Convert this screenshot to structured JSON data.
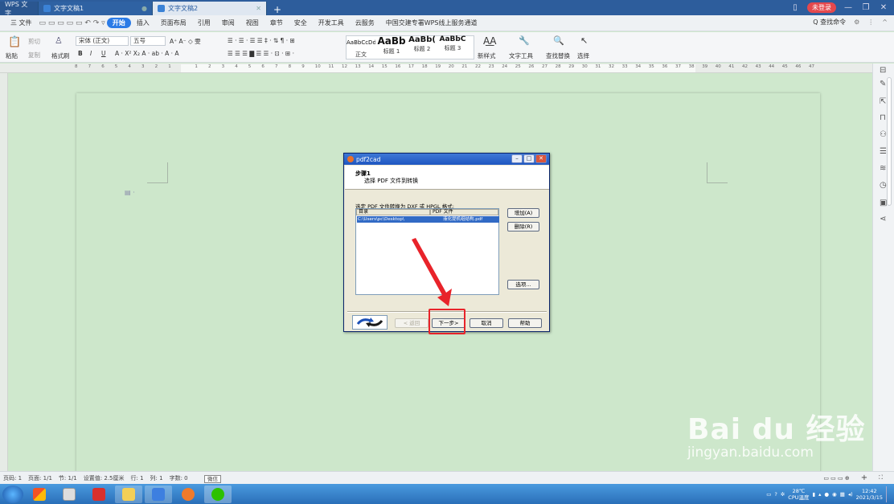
{
  "tabs": {
    "app": "WPS 文字",
    "doc1": "文字文稿1",
    "doc2": "文字文稿2",
    "new": "+"
  },
  "titlebar": {
    "login": "未登录"
  },
  "menu": {
    "file": "三 文件",
    "items": [
      "开始",
      "插入",
      "页面布局",
      "引用",
      "审阅",
      "视图",
      "章节",
      "安全",
      "开发工具",
      "云服务",
      "中国交建专署WPS线上服务通道"
    ],
    "search": "Q 查找命令"
  },
  "ribbon": {
    "paste": "粘贴",
    "cut": "剪切",
    "copy": "复制",
    "format_painter": "格式刷",
    "font_name": "宋体 (正文)",
    "font_size": "五号",
    "styles": [
      {
        "preview": "AaBbCcDd",
        "name": "正文"
      },
      {
        "preview": "AaBb",
        "name": "标题 1"
      },
      {
        "preview": "AaBb(",
        "name": "标题 2"
      },
      {
        "preview": "AaBbC",
        "name": "标题 3"
      }
    ],
    "new_style": "新样式",
    "text_tools": "文字工具",
    "find_replace": "查找替换",
    "select": "选择"
  },
  "ruler": {
    "ticks": [
      "8",
      "7",
      "6",
      "5",
      "4",
      "3",
      "2",
      "1",
      "",
      "1",
      "2",
      "3",
      "4",
      "5",
      "6",
      "7",
      "8",
      "9",
      "10",
      "11",
      "12",
      "13",
      "14",
      "15",
      "16",
      "17",
      "18",
      "19",
      "20",
      "21",
      "22",
      "23",
      "24",
      "25",
      "26",
      "27",
      "28",
      "29",
      "30",
      "31",
      "32",
      "33",
      "34",
      "35",
      "36",
      "37",
      "38",
      "39",
      "40",
      "41",
      "42",
      "43",
      "44",
      "45",
      "46",
      "47"
    ]
  },
  "dialog": {
    "title": "pdf2cad",
    "step": "步骤1",
    "step_desc": "选择 PDF 文件到转换",
    "instruction": "选定 PDF 文件转换为 DXF 或 HPGL 格式:",
    "col_dir": "目录",
    "col_file": "PDF 文件",
    "row_dir": "C:\\Users\\pc\\Desktop\\",
    "row_file": "液化提机组结构.pdf",
    "add": "增加(A)",
    "delete": "删除(R)",
    "options": "选项...",
    "back": "< 返回",
    "next": "下一步>",
    "cancel": "取消",
    "help": "帮助"
  },
  "status": {
    "page": "页码: 1",
    "pages": "页面: 1/1",
    "section": "节: 1/1",
    "setting": "设置值: 2.5厘米",
    "row": "行: 1",
    "col": "列: 1",
    "words": "字数: 0",
    "tooltip": "微信",
    "zoom_in": "+"
  },
  "tray": {
    "temp": "28℃",
    "temp_label": "CPU温度",
    "time": "12:42",
    "date": "2021/3/15"
  },
  "watermark": {
    "brand": "Bai du 经验",
    "url": "jingyan.baidu.com"
  },
  "colors": {
    "accent": "#2b7be6",
    "doc_bg": "#cfe8cd",
    "highlight_red": "#e8232a"
  }
}
